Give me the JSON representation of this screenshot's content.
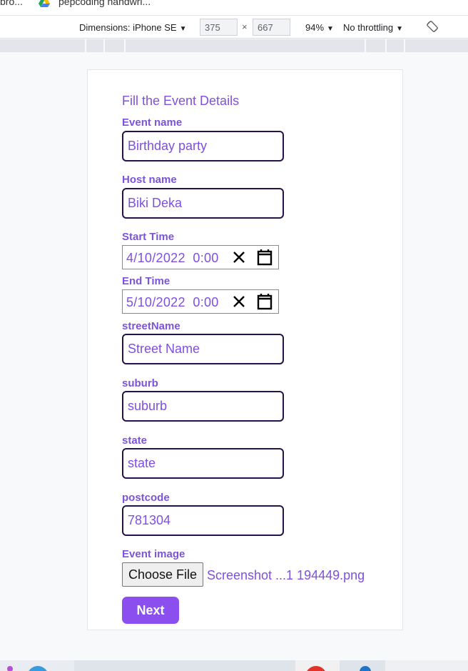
{
  "browser": {
    "bookmarks": [
      "bro...",
      "pepcoding handwri..."
    ]
  },
  "devtools": {
    "dimensions_label": "Dimensions: iPhone SE",
    "width": "375",
    "times": "×",
    "height": "667",
    "zoom": "94%",
    "throttling": "No throttling",
    "caret": "▼"
  },
  "form": {
    "title": "Fill the Event Details",
    "event_name": {
      "label": "Event name",
      "value": "Birthday party"
    },
    "host_name": {
      "label": "Host name",
      "value": "Biki Deka"
    },
    "start_time": {
      "label": "Start Time",
      "value": "4/10/2022  0:00"
    },
    "end_time": {
      "label": "End Time",
      "value": "5/10/2022  0:00"
    },
    "street_name": {
      "label": "streetName",
      "placeholder": "Street Name"
    },
    "suburb": {
      "label": "suburb",
      "placeholder": "suburb"
    },
    "state": {
      "label": "state",
      "placeholder": "state"
    },
    "postcode": {
      "label": "postcode",
      "value": "781304"
    },
    "event_image": {
      "label": "Event image",
      "button": "Choose File",
      "file_name": "Screenshot ...1 194449.png"
    },
    "next_button": "Next"
  },
  "colors": {
    "accent": "#7e4fe0",
    "label": "#7c53d9",
    "button": "#8b4ff0",
    "input_border": "#24124a"
  }
}
